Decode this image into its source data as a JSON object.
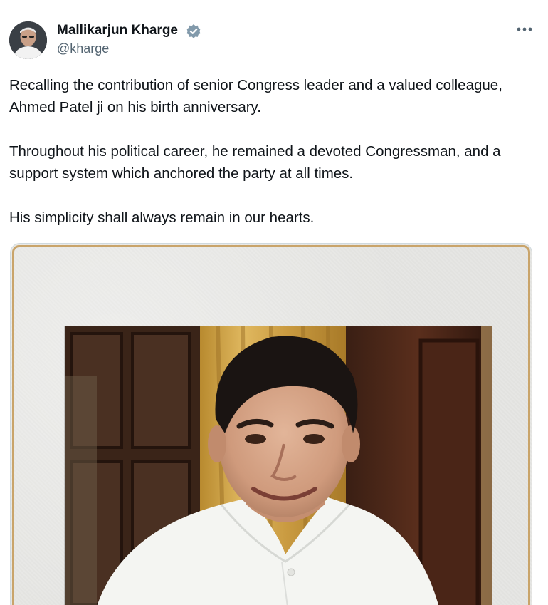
{
  "author": {
    "name": "Mallikarjun Kharge",
    "handle": "@kharge",
    "verified_color": "#829aab"
  },
  "post": {
    "paragraphs": [
      "Recalling the contribution of senior Congress leader and a valued colleague, Ahmed Patel ji on his birth anniversary.",
      "Throughout his political career, he remained a devoted Congressman, and a support system which anchored the party at all times.",
      "His simplicity shall always remain in our hearts."
    ]
  },
  "icons": {
    "verified": "verified-badge-icon",
    "more": "more-options-icon"
  }
}
